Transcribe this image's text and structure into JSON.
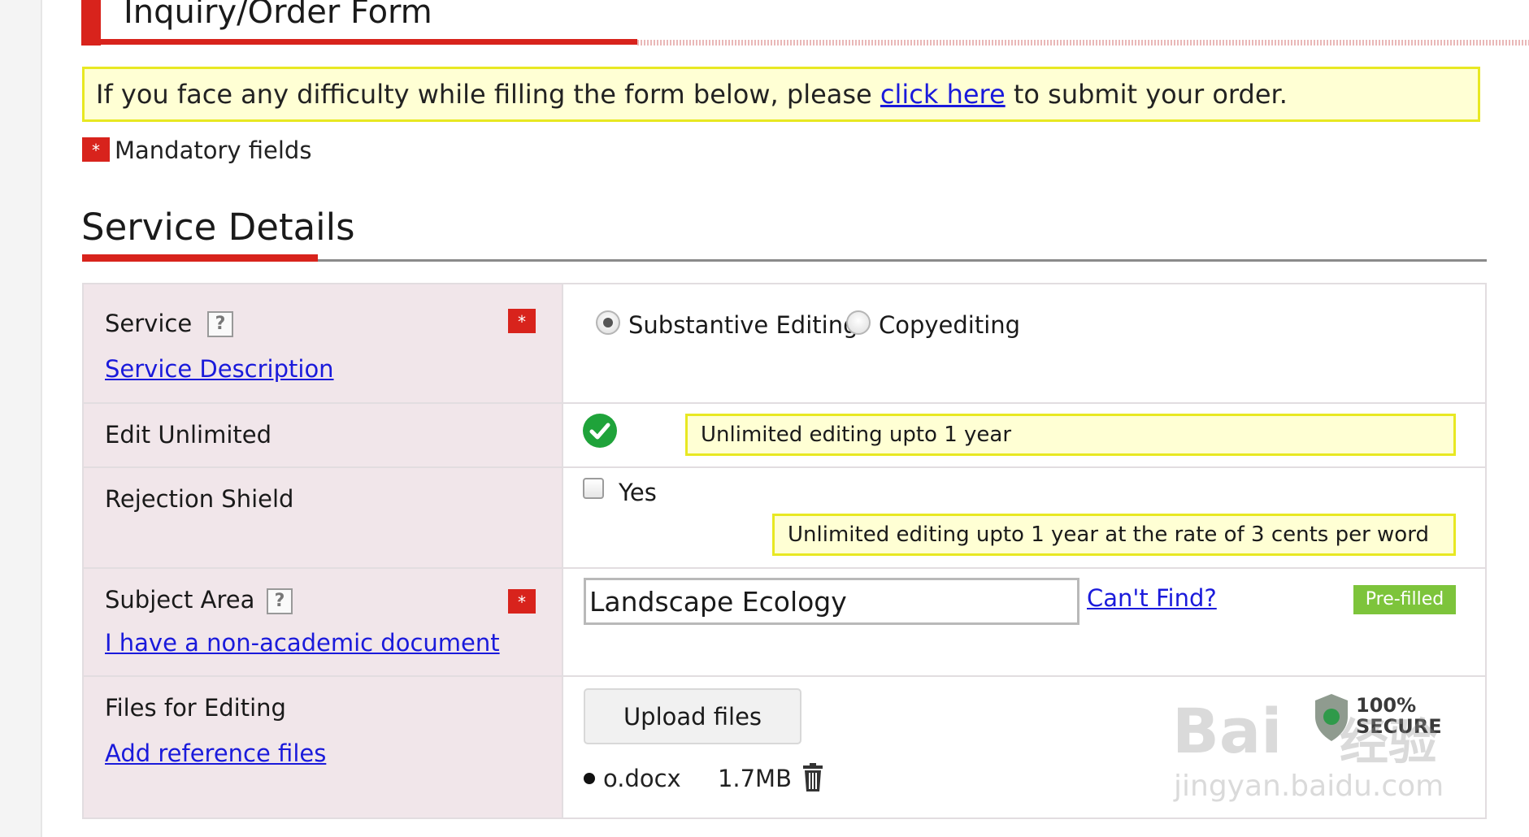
{
  "header": {
    "title": "Inquiry/Order Form"
  },
  "notice": {
    "text_before": "If you face any difficulty while filling the form below, please ",
    "link": "click here",
    "text_after": " to submit your order."
  },
  "mandatory": {
    "star": "*",
    "label": "Mandatory fields"
  },
  "section": {
    "title": "Service Details"
  },
  "form": {
    "service": {
      "label": "Service",
      "help": "?",
      "link": "Service Description",
      "options": [
        {
          "label": "Substantive Editing",
          "selected": true
        },
        {
          "label": "Copyediting",
          "selected": false
        }
      ]
    },
    "edit_unlimited": {
      "label": "Edit Unlimited",
      "note": "Unlimited editing upto 1 year"
    },
    "rejection_shield": {
      "label": "Rejection Shield",
      "checkbox_label": "Yes",
      "checked": false,
      "note": "Unlimited editing upto 1 year at the rate of 3 cents per word"
    },
    "subject_area": {
      "label": "Subject Area",
      "help": "?",
      "link": "I have a non-academic document",
      "value": "Landscape Ecology",
      "cant_find": "Can't Find?",
      "badge": "Pre-filled"
    },
    "files": {
      "label": "Files for Editing",
      "link": "Add reference files",
      "upload_label": "Upload files",
      "items": [
        {
          "name": "o.docx",
          "size": "1.7MB"
        }
      ]
    }
  },
  "badges": {
    "secure_line1": "100%",
    "secure_line2": "SECURE"
  },
  "watermark": {
    "logo": "Bai",
    "logo_suffix": "经验",
    "url": "jingyan.baidu.com"
  },
  "colors": {
    "accent": "#d8231c",
    "note_bg": "#ffffd4",
    "note_border": "#e8e822",
    "link": "#1a1adb",
    "success": "#1fa33a",
    "prefilled": "#7dc43b"
  },
  "icons": [
    "help-icon",
    "check-circle-icon",
    "trash-icon",
    "required-star-icon"
  ]
}
